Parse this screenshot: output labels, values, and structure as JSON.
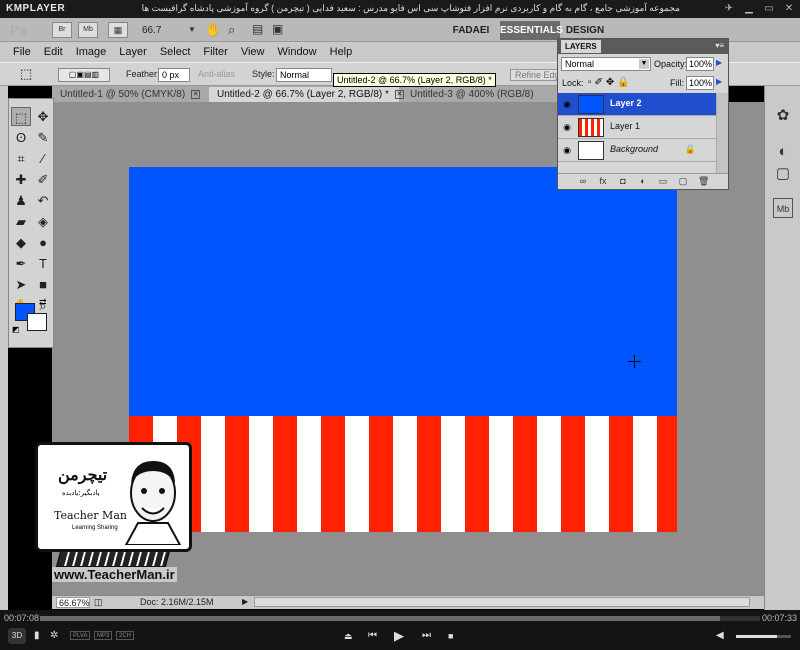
{
  "player": {
    "logo": "KMPLAYER",
    "caption": "مجموعه آموزشی جامع ، گام به گام و کاربردی نرم افزار فتوشاپ سی اس فایو  مدرس : سعید فدایی ( تیچرمن ) گروه آموزشی پادشاه گرافیست ها",
    "time_elapsed": "00:07:08",
    "time_total": "00:07:33",
    "progress": 0.945,
    "volume": 0.75,
    "tags": [
      "PLVA",
      "MP3",
      "2CH"
    ],
    "badge_3d": "3D"
  },
  "photoshop": {
    "logo": "Ps",
    "appbar_buttons": [
      "Br",
      "Mb"
    ],
    "zoom": "66.7",
    "workspaces": [
      "FADAEI",
      "ESSENTIALS",
      "DESIGN"
    ],
    "menu": [
      "File",
      "Edit",
      "Image",
      "Layer",
      "Select",
      "Filter",
      "View",
      "Window",
      "Help"
    ],
    "options": {
      "feather_label": "Feather:",
      "feather_value": "0 px",
      "antialias": "Anti-alias",
      "style_label": "Style:",
      "style_value": "Normal",
      "refine_edge": "Refine Edge..."
    },
    "tooltip": "Untitled-2 @ 66.7% (Layer 2, RGB/8) *",
    "tabs": [
      {
        "label": "Untitled-1 @ 50% (CMYK/8)",
        "active": false
      },
      {
        "label": "Untitled-2 @ 66.7% (Layer 2, RGB/8) *",
        "active": true
      },
      {
        "label": "Untitled-3 @ 400% (RGB/8)",
        "active": false
      }
    ],
    "status": {
      "zoom": "66.67%",
      "doc": "Doc: 2.16M/2.15M"
    },
    "colors": {
      "foreground": "#0055ff",
      "background": "#ffffff",
      "canvas_blue": "#0055ff",
      "stripe_red": "#ff2200"
    }
  },
  "layers_panel": {
    "title": "LAYERS",
    "blend_mode": "Normal",
    "opacity_label": "Opacity:",
    "opacity": "100%",
    "lock_label": "Lock:",
    "fill_label": "Fill:",
    "fill": "100%",
    "layers": [
      {
        "name": "Layer 2",
        "selected": true
      },
      {
        "name": "Layer 1",
        "selected": false
      },
      {
        "name": "Background",
        "selected": false,
        "locked": true
      }
    ]
  },
  "watermark": {
    "logo_fa": "تیچرمن",
    "logo_fa_sub": "یادبگیر؛یادبده",
    "logo_en": "Teacher Man",
    "logo_en_sub": "Learning Sharing",
    "url": "www.TeacherMan.ir"
  }
}
